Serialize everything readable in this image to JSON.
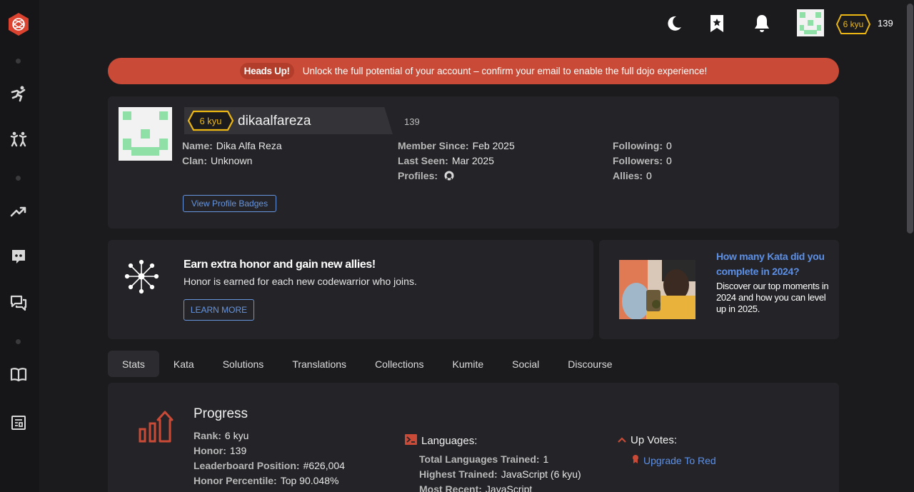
{
  "colors": {
    "accent_red": "#c94a36",
    "kyu_yellow": "#ecb613",
    "link_blue": "#5c8fe6"
  },
  "sidebar": {
    "items": [
      {
        "icon": "training-icon"
      },
      {
        "icon": "kumite-icon"
      },
      {
        "icon": "leaderboard-icon"
      },
      {
        "icon": "discord-icon"
      },
      {
        "icon": "discussions-icon"
      },
      {
        "icon": "docs-icon"
      },
      {
        "icon": "blog-icon"
      }
    ]
  },
  "topbar": {
    "rank": "6 kyu",
    "honor": "139"
  },
  "banner": {
    "tag": "Heads Up!",
    "message": "Unlock the full potential of your account – confirm your email to enable the full dojo experience!"
  },
  "profile": {
    "rank": "6 kyu",
    "username": "dikaalfareza",
    "honor": "139",
    "col1": [
      {
        "label": "Name:",
        "value": "Dika Alfa Reza"
      },
      {
        "label": "Clan:",
        "value": "Unknown"
      }
    ],
    "col2": [
      {
        "label": "Member Since:",
        "value": "Feb 2025"
      },
      {
        "label": "Last Seen:",
        "value": "Mar 2025"
      },
      {
        "label": "Profiles:",
        "value": ""
      }
    ],
    "col3": [
      {
        "label": "Following:",
        "value": "0"
      },
      {
        "label": "Followers:",
        "value": "0"
      },
      {
        "label": "Allies:",
        "value": "0"
      }
    ],
    "badges_button": "View Profile Badges"
  },
  "promo": {
    "title": "Earn extra honor and gain new allies!",
    "subtitle": "Honor is earned for each new codewarrior who joins.",
    "button": "LEARN MORE"
  },
  "ad": {
    "title": "How many Kata did you complete in 2024?",
    "text": "Discover our top moments in 2024 and how you can level up in 2025."
  },
  "tabs": [
    "Stats",
    "Kata",
    "Solutions",
    "Translations",
    "Collections",
    "Kumite",
    "Social",
    "Discourse"
  ],
  "progress": {
    "title": "Progress",
    "stats": [
      {
        "label": "Rank:",
        "value": "6 kyu"
      },
      {
        "label": "Honor:",
        "value": "139"
      },
      {
        "label": "Leaderboard Position:",
        "value": "#626,004"
      },
      {
        "label": "Honor Percentile:",
        "value": "Top 90.048%"
      }
    ],
    "languages_title": "Languages:",
    "languages": [
      {
        "label": "Total Languages Trained:",
        "value": "1"
      },
      {
        "label": "Highest Trained:",
        "value": "JavaScript (6 kyu)"
      },
      {
        "label": "Most Recent:",
        "value": "JavaScript"
      }
    ],
    "upvotes_title": "Up Votes:",
    "upvotes_link": "Upgrade To Red"
  }
}
